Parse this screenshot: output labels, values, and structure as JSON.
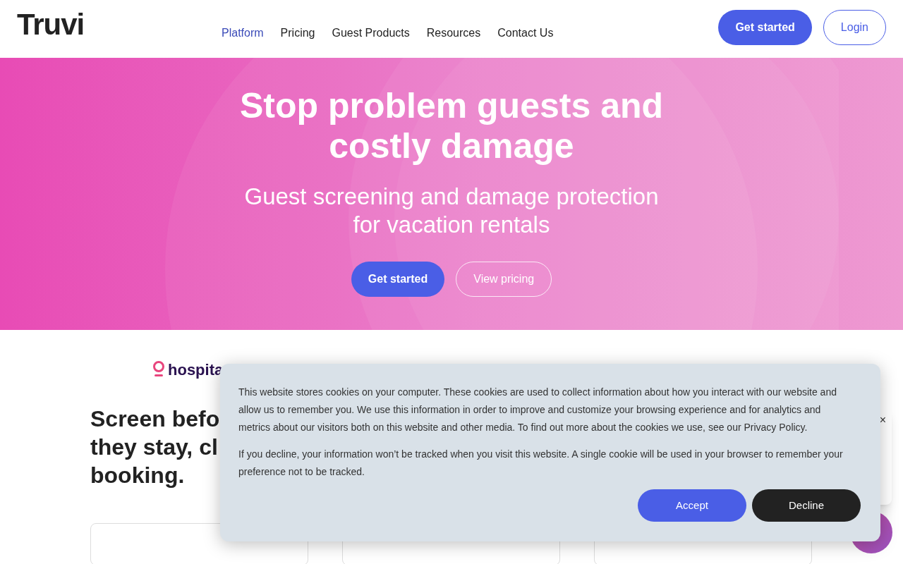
{
  "header": {
    "logo": "Truvi",
    "nav": [
      {
        "label": "Platform",
        "selected": true
      },
      {
        "label": "Pricing",
        "selected": false
      },
      {
        "label": "Guest Products",
        "selected": false
      },
      {
        "label": "Resources",
        "selected": false
      },
      {
        "label": "Contact Us",
        "selected": false
      }
    ],
    "buttons": [
      {
        "label": "Get started",
        "kind": "primary"
      },
      {
        "label": "Login",
        "kind": "outline"
      }
    ]
  },
  "hero": {
    "title": "Stop problem guests and costly damage",
    "subtitle": "Guest screening and damage protection for vacation rentals",
    "buttons": [
      {
        "label": "Get started",
        "kind": "primary"
      },
      {
        "label": "View pricing",
        "kind": "outline"
      }
    ]
  },
  "partner_logos": [
    "hospita"
  ],
  "section": {
    "heading_lines": [
      "Screen befo",
      "they stay, cl",
      "booking."
    ]
  },
  "chat_popup": {
    "close": "×"
  },
  "cookie_banner": {
    "paragraphs": [
      "This website stores cookies on your computer. These cookies are used to collect information about how you interact with our website and allow us to remember you. We use this information in order to improve and customize your browsing experience and for analytics and metrics about our visitors both on this website and other media. To find out more about the cookies we use, see our Privacy Policy.",
      "If you decline, your information won’t be tracked when you visit this website. A single cookie will be used in your browser to remember your preference not to be tracked."
    ],
    "buttons": [
      {
        "label": "Accept",
        "kind": "accept"
      },
      {
        "label": "Decline",
        "kind": "decline"
      }
    ]
  }
}
